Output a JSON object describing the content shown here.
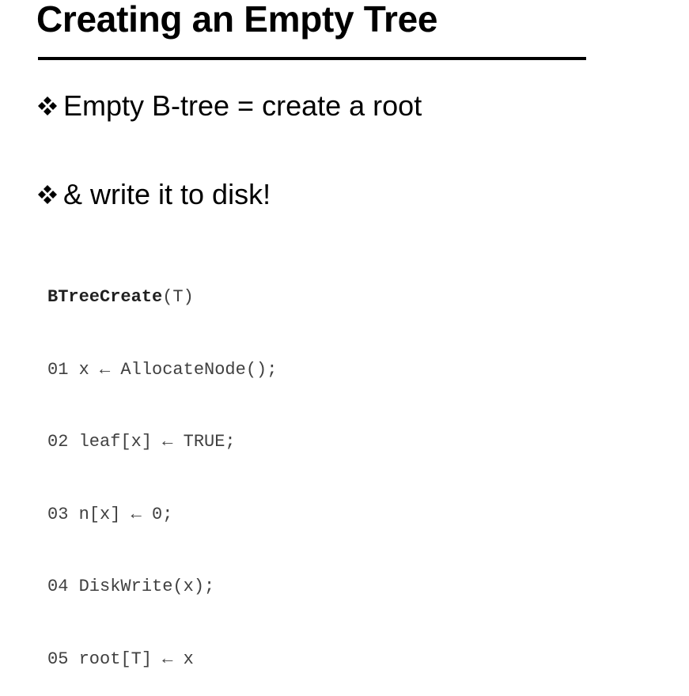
{
  "slide": {
    "title": "Creating an Empty Tree",
    "bullets": [
      {
        "icon": "four-diamond-bullet-icon",
        "text": "Empty B-tree = create a root"
      },
      {
        "icon": "four-diamond-bullet-icon",
        "text": "& write it to disk!"
      }
    ],
    "code": {
      "header_fn": "BTreeCreate",
      "header_args": "(T)",
      "lines": [
        "01 x ← AllocateNode();",
        "02 leaf[x] ← TRUE;",
        "03 n[x] ← 0;",
        "04 DiskWrite(x);",
        "05 root[T] ← x"
      ]
    }
  }
}
